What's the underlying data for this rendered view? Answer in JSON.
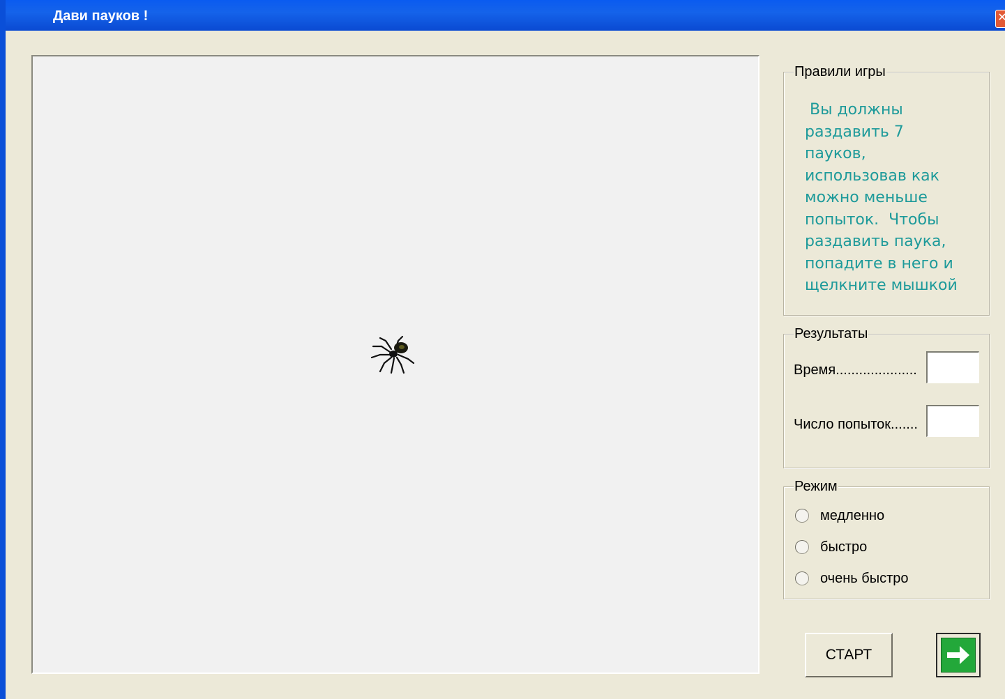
{
  "window": {
    "title": "Дави пауков !"
  },
  "icons": {
    "close": "close-icon",
    "spider": "spider-icon",
    "next": "arrow-right-icon"
  },
  "rules": {
    "legend": "Правили игры",
    "lines": [
      " Вы должны",
      "раздавить 7",
      "пауков,",
      "использовав как",
      "можно меньше",
      "попыток.  Чтобы",
      "раздавить паука,",
      "попадите в него и",
      "щелкните мышкой"
    ]
  },
  "results": {
    "legend": "Результаты",
    "time_label": "Время.....................",
    "time_value": "",
    "attempts_label": "Число попыток.......",
    "attempts_value": ""
  },
  "mode": {
    "legend": "Режим",
    "options": [
      "медленно",
      "быстро",
      "очень быстро"
    ],
    "selected": null
  },
  "buttons": {
    "start": "СТАРТ"
  },
  "colors": {
    "rules_text": "#1d9a9a",
    "titlebar": "#0a5bf0",
    "window_bg": "#ece9d8",
    "next_button": "#23a83a"
  }
}
